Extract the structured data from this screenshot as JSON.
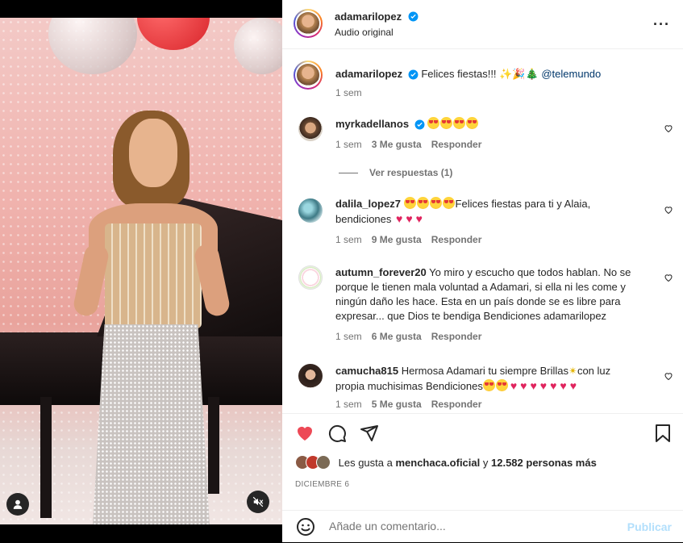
{
  "header": {
    "username": "adamarilopez",
    "subtitle": "Audio original",
    "more_icon": "more-horizontal-icon"
  },
  "caption": {
    "username": "adamarilopez",
    "text": "Felices fiestas!!!",
    "mention": "@telemundo",
    "time": "1 sem"
  },
  "comments": [
    {
      "username": "myrkadellanos",
      "verified": true,
      "time": "1 sem",
      "likes": "3 Me gusta",
      "reply": "Responder"
    },
    {
      "username": "dalila_lopez7",
      "text1": "Felices fiestas para ti y Alaia,",
      "text2": "bendiciones",
      "time": "1 sem",
      "likes": "9 Me gusta",
      "reply": "Responder"
    },
    {
      "username": "autumn_forever20",
      "text1": "Yo miro y escucho que todos hablan. No se",
      "text2": "porque le tienen mala voluntad a Adamari, si ella ni les come y",
      "text3": "ningún daño les hace. Esta en un país donde se es libre para",
      "text4": "expresar... que Dios te bendiga Bendiciones adamarilopez",
      "time": "1 sem",
      "likes": "6 Me gusta",
      "reply": "Responder"
    },
    {
      "username": "camucha815",
      "text1": "Hermosa Adamari tu siempre Brillas",
      "text1b": "con luz",
      "text2": "propia muchisimas Bendiciones",
      "time": "1 sem",
      "likes": "5 Me gusta",
      "reply": "Responder"
    }
  ],
  "view_replies": "Ver respuestas (1)",
  "likes_line": {
    "prefix": "Les gusta a",
    "user": "menchaca.oficial",
    "mid": "y",
    "count": "12.582 personas más"
  },
  "date": "DICIEMBRE 6",
  "comment_box": {
    "placeholder": "Añade un comentario...",
    "publish": "Publicar"
  },
  "colors": {
    "like_red": "#ed4956",
    "verified_blue": "#0095f6",
    "publish_disabled": "#b2dffc"
  }
}
